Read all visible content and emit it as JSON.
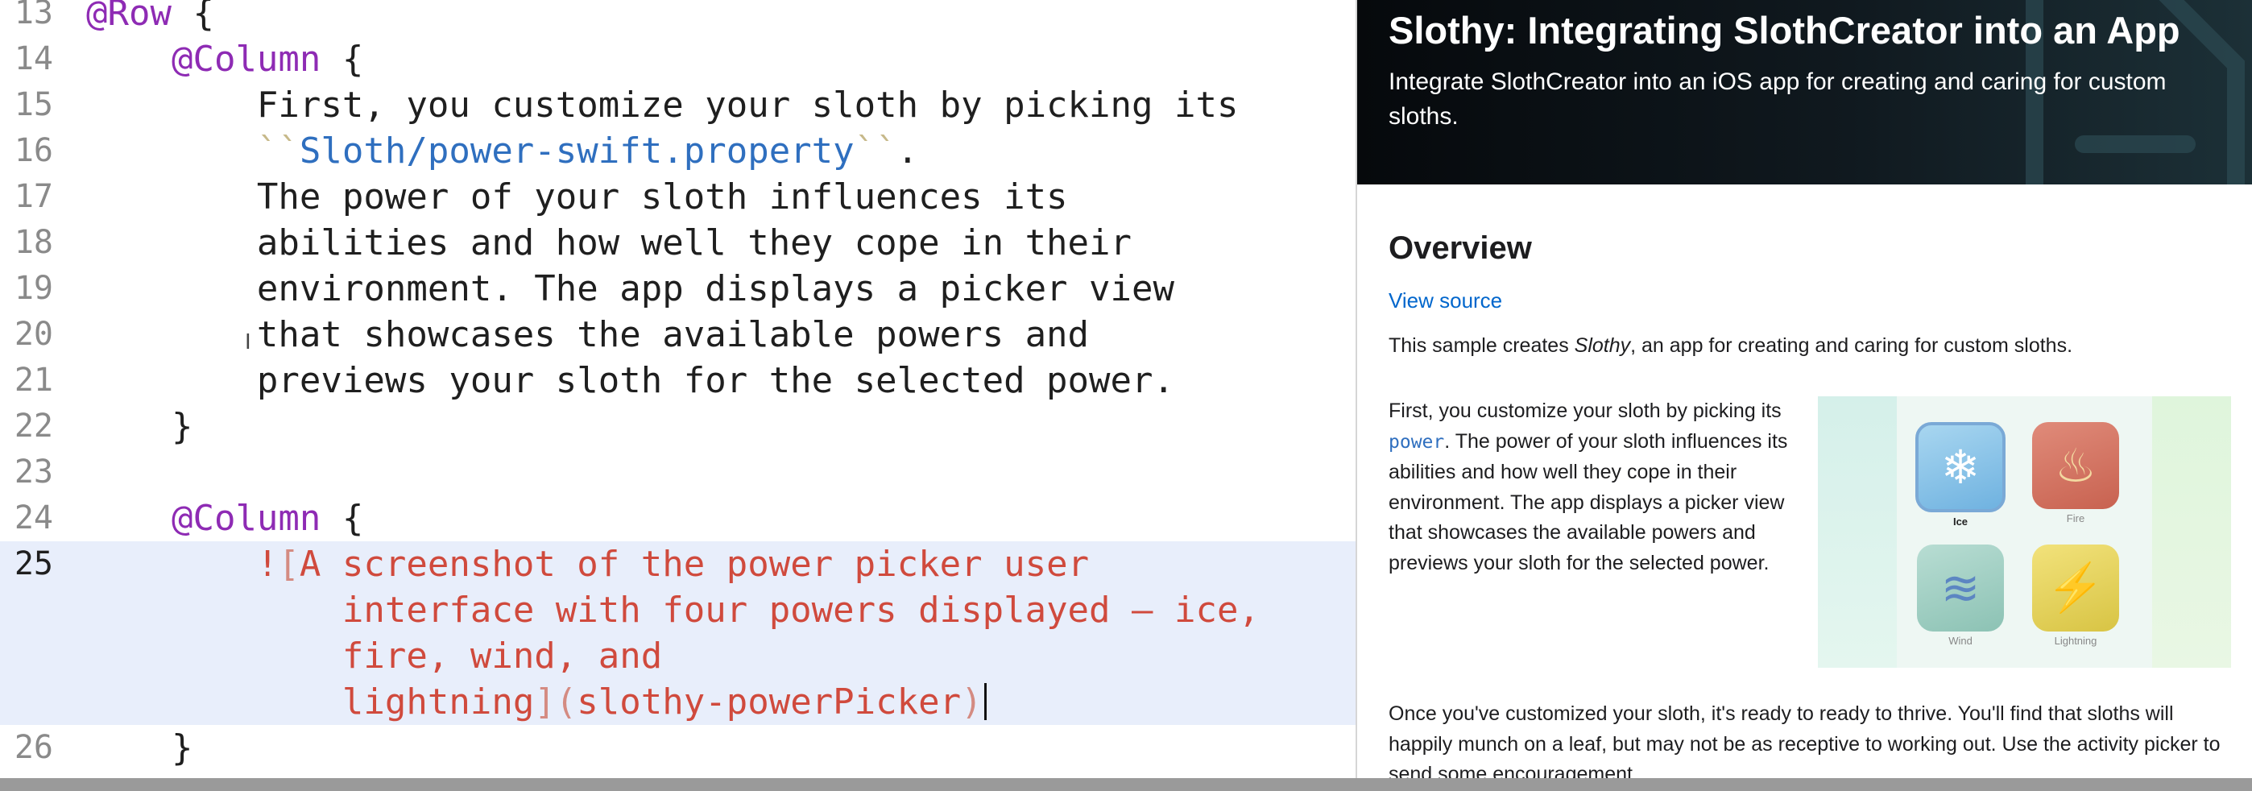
{
  "editor": {
    "lines": [
      {
        "num": "13",
        "parts": [
          {
            "cls": "kw",
            "text": "@Row"
          },
          {
            "cls": "",
            "text": " {"
          }
        ]
      },
      {
        "num": "14",
        "parts": [
          {
            "cls": "",
            "text": "    "
          },
          {
            "cls": "kw",
            "text": "@Column"
          },
          {
            "cls": "",
            "text": " {"
          }
        ]
      },
      {
        "num": "15",
        "parts": [
          {
            "cls": "",
            "text": "        First, you customize your sloth by picking its"
          }
        ]
      },
      {
        "num": "16",
        "parts": [
          {
            "cls": "",
            "text": "        "
          },
          {
            "cls": "tick",
            "text": "``"
          },
          {
            "cls": "link",
            "text": "Sloth/power-swift.property"
          },
          {
            "cls": "tick",
            "text": "``"
          },
          {
            "cls": "",
            "text": "."
          }
        ]
      },
      {
        "num": "17",
        "parts": [
          {
            "cls": "",
            "text": "        The power of your sloth influences its"
          }
        ]
      },
      {
        "num": "18",
        "parts": [
          {
            "cls": "",
            "text": "        abilities and how well they cope in their"
          }
        ]
      },
      {
        "num": "19",
        "parts": [
          {
            "cls": "",
            "text": "        environment. The app displays a picker view"
          }
        ]
      },
      {
        "num": "20",
        "parts": [
          {
            "cls": "",
            "text": "        that showcases the available powers and"
          }
        ]
      },
      {
        "num": "21",
        "parts": [
          {
            "cls": "",
            "text": "        previews your sloth for the selected power."
          }
        ]
      },
      {
        "num": "22",
        "parts": [
          {
            "cls": "",
            "text": "    }"
          }
        ]
      },
      {
        "num": "23",
        "parts": []
      },
      {
        "num": "24",
        "parts": [
          {
            "cls": "",
            "text": "    "
          },
          {
            "cls": "kw",
            "text": "@Column"
          },
          {
            "cls": "",
            "text": " {"
          }
        ]
      },
      {
        "num": "25",
        "current": true,
        "parts": [
          {
            "cls": "",
            "text": "        "
          },
          {
            "cls": "md-img",
            "text": "!"
          },
          {
            "cls": "md-bracket",
            "text": "["
          },
          {
            "cls": "md-img",
            "text": "A screenshot of the power picker user"
          }
        ]
      },
      {
        "num": "",
        "current": true,
        "parts": [
          {
            "cls": "",
            "text": "            "
          },
          {
            "cls": "md-img",
            "text": "interface with four powers displayed — ice,"
          }
        ]
      },
      {
        "num": "",
        "current": true,
        "parts": [
          {
            "cls": "",
            "text": "            "
          },
          {
            "cls": "md-img",
            "text": "fire, wind, and"
          }
        ]
      },
      {
        "num": "",
        "current": true,
        "caret": true,
        "parts": [
          {
            "cls": "",
            "text": "            "
          },
          {
            "cls": "md-img",
            "text": "lightning"
          },
          {
            "cls": "md-bracket",
            "text": "]("
          },
          {
            "cls": "md-img",
            "text": "slothy-powerPicker"
          },
          {
            "cls": "md-bracket",
            "text": ")"
          }
        ]
      },
      {
        "num": "26",
        "parts": [
          {
            "cls": "",
            "text": "    }"
          }
        ]
      }
    ]
  },
  "preview": {
    "hero_title": "Slothy: Integrating SlothCreator into an App",
    "hero_subtitle": "Integrate SlothCreator into an iOS app for creating and caring for custom sloths.",
    "overview_heading": "Overview",
    "view_source": "View source",
    "intro_before": "This sample creates ",
    "intro_em": "Slothy",
    "intro_after": ", an app for creating and caring for custom sloths.",
    "col_before": "First, you customize your sloth by picking its ",
    "col_code": "power",
    "col_after": ". The power of your sloth influences its abilities and how well they cope in their environment. The app displays a picker view that showcases the available powers and previews your sloth for the selected power.",
    "powers": [
      {
        "label": "Ice",
        "icon": "snowflake-icon",
        "glyph": "❄"
      },
      {
        "label": "Fire",
        "icon": "fire-icon",
        "glyph": "♨"
      },
      {
        "label": "Wind",
        "icon": "wind-icon",
        "glyph": "≋"
      },
      {
        "label": "Lightning",
        "icon": "lightning-icon",
        "glyph": "⚡"
      }
    ],
    "outro": "Once you've customized your sloth, it's ready to ready to thrive. You'll find that sloths will happily munch on a leaf, but may not be as receptive to working out. Use the activity picker to send some encouragement."
  }
}
